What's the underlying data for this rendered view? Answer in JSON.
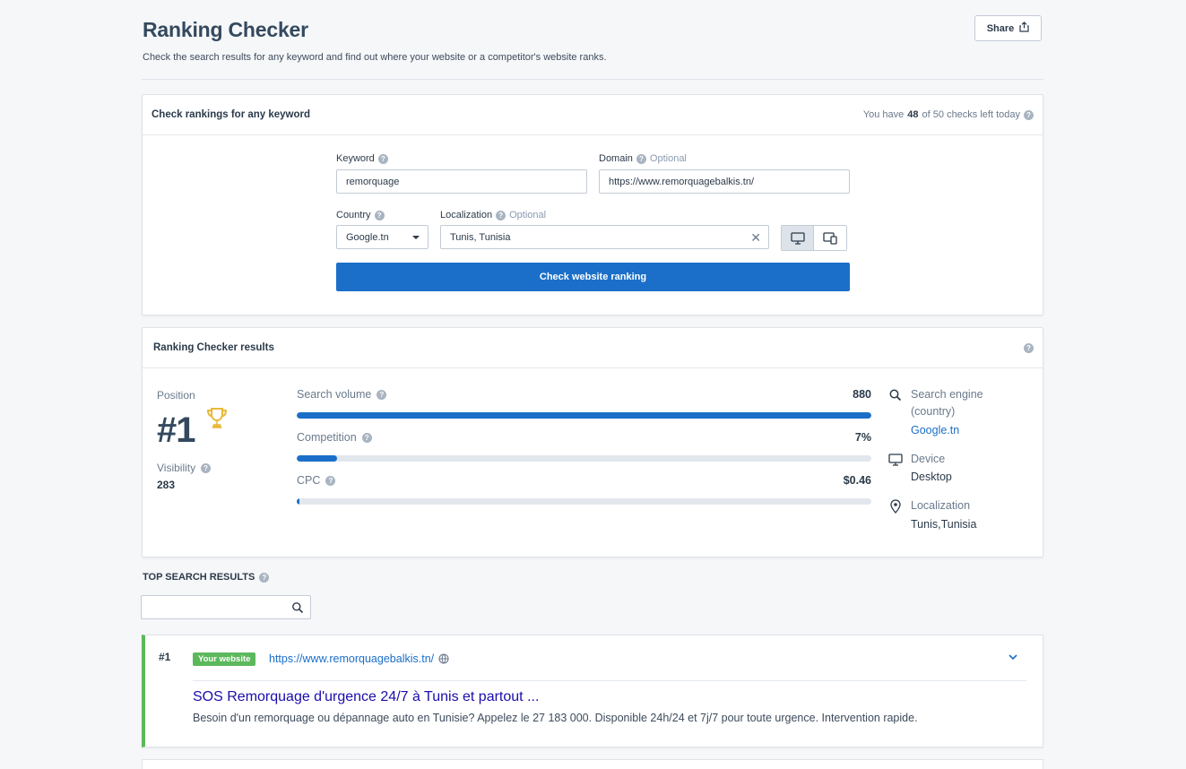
{
  "header": {
    "title": "Ranking Checker",
    "subtitle": "Check the search results for any keyword and find out where your website or a competitor's website ranks.",
    "share_label": "Share"
  },
  "check_card": {
    "heading": "Check rankings for any keyword",
    "checks_prefix": "You have",
    "checks_left": "48",
    "checks_suffix": "of 50 checks left today",
    "keyword_label": "Keyword",
    "keyword_value": "remorquage",
    "domain_label": "Domain",
    "domain_optional": "Optional",
    "domain_value": "https://www.remorquagebalkis.tn/",
    "country_label": "Country",
    "country_value": "Google.tn",
    "localization_label": "Localization",
    "localization_optional": "Optional",
    "localization_value": "Tunis, Tunisia",
    "submit_label": "Check website ranking"
  },
  "results_card": {
    "heading": "Ranking Checker results",
    "position_label": "Position",
    "position_value": "#1",
    "visibility_label": "Visibility",
    "visibility_value": "283",
    "metrics": [
      {
        "label": "Search volume",
        "value": "880",
        "fill_pct": 100
      },
      {
        "label": "Competition",
        "value": "7%",
        "fill_pct": 7
      },
      {
        "label": "CPC",
        "value": "$0.46",
        "fill_pct": 0.5
      }
    ],
    "search_engine_label_1": "Search engine",
    "search_engine_label_2": "(country)",
    "search_engine_value": "Google.tn",
    "device_label": "Device",
    "device_value": "Desktop",
    "localization_label": "Localization",
    "localization_value": "Tunis,Tunisia"
  },
  "top_results": {
    "heading": "TOP SEARCH RESULTS",
    "search_placeholder": "",
    "items": [
      {
        "rank": "#1",
        "badge": "Your website",
        "url": "https://www.remorquagebalkis.tn/",
        "title": "SOS Remorquage d'urgence 24/7 à Tunis et partout ...",
        "description": "Besoin d'un remorquage ou dépannage auto en Tunisie? Appelez le 27 183 000. Disponible 24h/24 et 7j/7 pour toute urgence. Intervention rapide."
      }
    ]
  },
  "colors": {
    "primary": "#1b6fc9",
    "success": "#5cb85c",
    "trophy": "#e8b93a"
  }
}
